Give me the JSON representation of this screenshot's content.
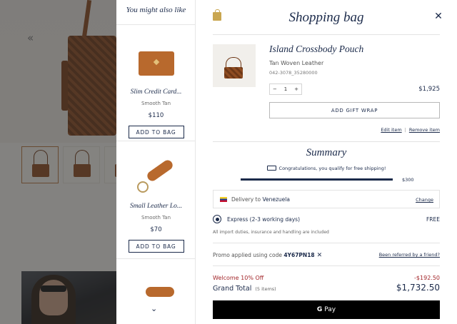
{
  "recommendations": {
    "heading": "You might also like",
    "items": [
      {
        "name": "Slim Credit Card...",
        "material": "Smooth Tan",
        "price": "$110",
        "button": "ADD TO BAG"
      },
      {
        "name": "Small Leather Lo...",
        "material": "Smooth Tan",
        "price": "$70",
        "button": "ADD TO BAG"
      }
    ]
  },
  "bag": {
    "title": "Shopping bag",
    "item": {
      "name": "Island Crossbody Pouch",
      "material": "Tan Woven Leather",
      "sku": "042-3078_35280000",
      "quantity": "1",
      "minus": "−",
      "plus": "+",
      "price": "$1,925",
      "gift_wrap": "ADD GIFT WRAP",
      "edit": "Edit item",
      "remove": "Remove item"
    },
    "summary": {
      "title": "Summary",
      "shipping_note": "Congratulations, you qualify for free shipping!",
      "progress": 1.0,
      "threshold": "$300",
      "delivery_prefix": "Delivery to",
      "delivery_country": "Venezuela",
      "change": "Change",
      "ship_method": "Express (2-3 working days)",
      "ship_cost": "FREE",
      "duties": "All import duties, insurance and handling are included",
      "promo_prefix": "Promo applied using code",
      "promo_code": "4Y67PN18",
      "referral": "Been referred by a friend?",
      "discount_label": "Welcome 10% Off",
      "discount_amount": "-$192.50",
      "grand_total_label": "Grand Total",
      "item_count": "(5 items)",
      "grand_total": "$1,732.50",
      "pay_g": "G",
      "pay_label": "Pay"
    }
  },
  "colors": {
    "navy": "#1b2a4a",
    "discount": "#a3272b",
    "leather": "#b8692d"
  },
  "icons": [
    "chevron-left-icon",
    "shopping-bag-icon",
    "close-icon",
    "truck-icon",
    "venezuela-flag-icon",
    "radio-selected-icon",
    "remove-promo-icon",
    "chevron-down-icon"
  ]
}
